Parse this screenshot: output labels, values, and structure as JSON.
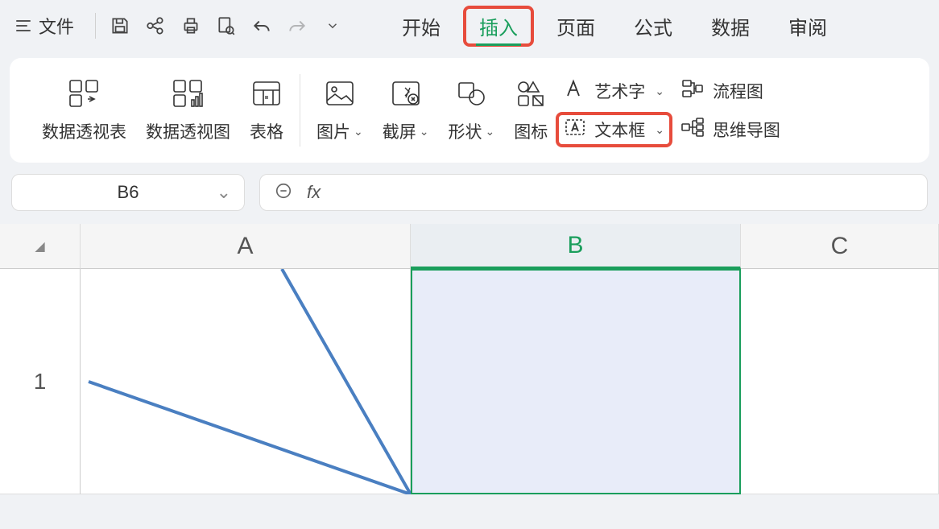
{
  "menubar": {
    "file_label": "文件",
    "tabs": [
      "开始",
      "插入",
      "页面",
      "公式",
      "数据",
      "审阅"
    ],
    "active_tab": "插入"
  },
  "ribbon": {
    "pivot_table": "数据透视表",
    "pivot_chart": "数据透视图",
    "table": "表格",
    "picture": "图片",
    "screenshot": "截屏",
    "shapes": "形状",
    "icons": "图标",
    "wordart": "艺术字",
    "textbox": "文本框",
    "flowchart": "流程图",
    "mindmap": "思维导图"
  },
  "namebox": {
    "value": "B6"
  },
  "fx": {
    "label": "fx"
  },
  "columns": [
    "A",
    "B",
    "C"
  ],
  "rows": [
    "1"
  ]
}
